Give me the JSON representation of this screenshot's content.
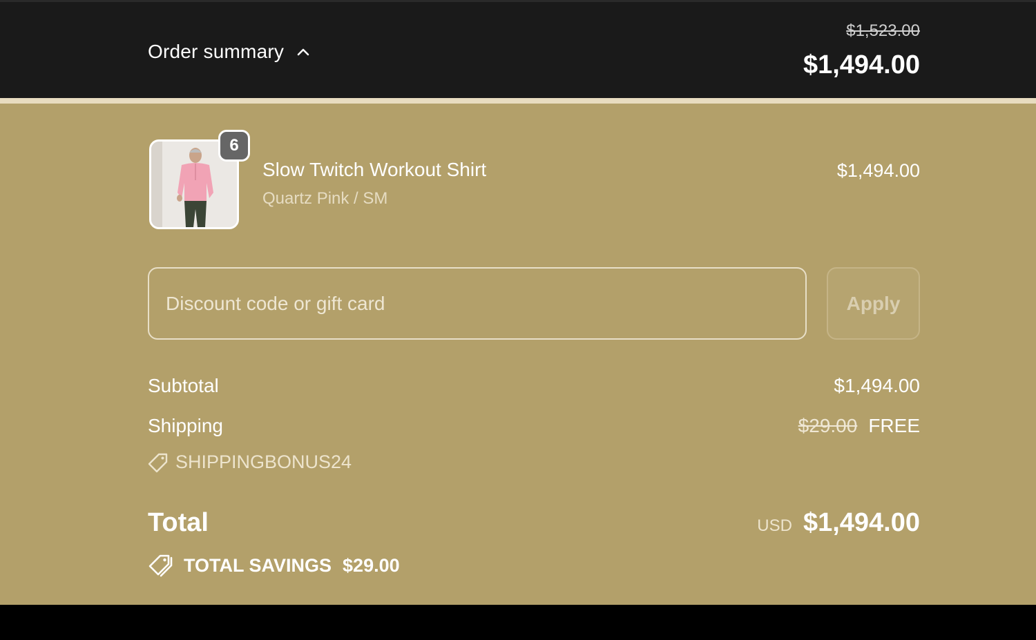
{
  "header": {
    "toggle_label": "Order summary",
    "compare_price": "$1,523.00",
    "price": "$1,494.00"
  },
  "product": {
    "name": "Slow Twitch Workout Shirt",
    "variant": "Quartz Pink / SM",
    "price": "$1,494.00",
    "quantity": "6"
  },
  "discount": {
    "placeholder": "Discount code or gift card",
    "apply_label": "Apply"
  },
  "lines": {
    "subtotal_label": "Subtotal",
    "subtotal_value": "$1,494.00",
    "shipping_label": "Shipping",
    "shipping_original": "$29.00",
    "shipping_value": "FREE",
    "promo_code": "SHIPPINGBONUS24"
  },
  "total": {
    "label": "Total",
    "currency": "USD",
    "amount": "$1,494.00",
    "savings_label": "TOTAL SAVINGS",
    "savings_amount": "$29.00"
  },
  "colors": {
    "header_bg": "#1a1a1a",
    "panel_bg": "#b3a06a",
    "text": "#ffffff",
    "badge_bg": "#666666"
  },
  "icons": {
    "toggle": "chevron-up-icon",
    "promo": "tag-icon",
    "savings": "tags-icon"
  }
}
